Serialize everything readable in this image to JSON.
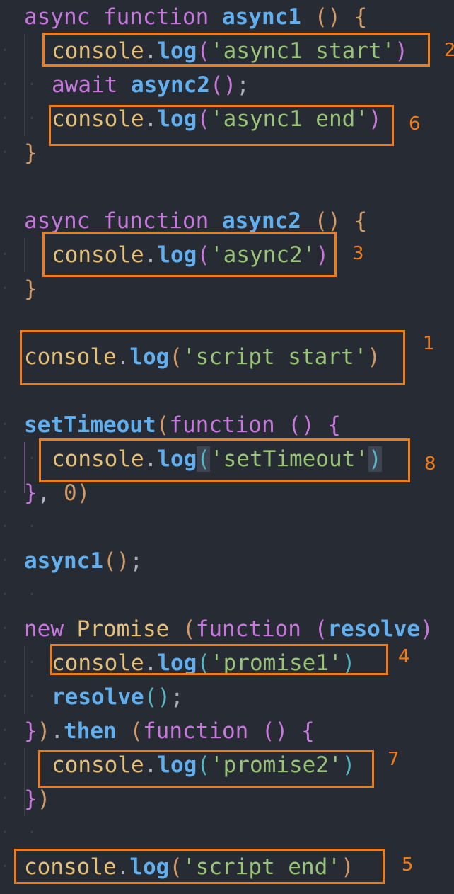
{
  "code": {
    "l1": {
      "kw": "async function ",
      "name": "async1",
      "rest_open": " () ",
      "brace": "{"
    },
    "l2": {
      "obj": "console",
      "dot": ".",
      "method": "log",
      "open": "(",
      "str": "'async1 start'",
      "close": ")"
    },
    "l3": {
      "kw": "await ",
      "call": "async2",
      "parens": "()",
      "semi": ";"
    },
    "l4": {
      "obj": "console",
      "dot": ".",
      "method": "log",
      "open": "(",
      "str": "'async1 end'",
      "close": ")"
    },
    "l5": {
      "brace": "}"
    },
    "l7": {
      "kw": "async function ",
      "name": "async2",
      "rest_open": " () ",
      "brace": "{"
    },
    "l8": {
      "obj": "console",
      "dot": ".",
      "method": "log",
      "open": "(",
      "str": "'async2'",
      "close": ")"
    },
    "l9": {
      "brace": "}"
    },
    "l11": {
      "obj": "console",
      "dot": ".",
      "method": "log",
      "open": "(",
      "str": "'script start'",
      "close": ")"
    },
    "l13": {
      "name": "setTimeout",
      "open": "(",
      "kw": "function",
      "parens": " () ",
      "brace": "{"
    },
    "l14": {
      "obj": "console",
      "dot": ".",
      "method": "log",
      "open": "(",
      "str": "'setTimeout'",
      "close": ")"
    },
    "l15": {
      "brace": "}",
      "comma": ", ",
      "num": "0",
      "close": ")"
    },
    "l17": {
      "call": "async1",
      "parens": "()",
      "semi": ";"
    },
    "l19": {
      "kw": "new ",
      "cls": "Promise",
      "sp": " ",
      "open": "(",
      "fnkw": "function",
      "sp2": " ",
      "p_open": "(",
      "param": "resolve",
      "p_close": ")"
    },
    "l20": {
      "obj": "console",
      "dot": ".",
      "method": "log",
      "open": "(",
      "str": "'promise1'",
      "close": ")"
    },
    "l21": {
      "call": "resolve",
      "parens": "()",
      "semi": ";"
    },
    "l22": {
      "brace": "}",
      "close": ")",
      "dot": ".",
      "method": "then",
      "sp": " ",
      "open": "(",
      "kw": "function",
      "parens": " () ",
      "brace2": "{"
    },
    "l23": {
      "obj": "console",
      "dot": ".",
      "method": "log",
      "open": "(",
      "str": "'promise2'",
      "close": ")"
    },
    "l24": {
      "brace": "}",
      "close": ")"
    },
    "l26": {
      "obj": "console",
      "dot": ".",
      "method": "log",
      "open": "(",
      "str": "'script end'",
      "close": ")"
    }
  },
  "annotations": {
    "async1_start": "2",
    "async1_end": "6",
    "async2": "3",
    "script_start": "1",
    "settimeout": "8",
    "promise1": "4",
    "promise2": "7",
    "script_end": "5"
  },
  "colors": {
    "background": "#272b33",
    "highlight_box": "#f27b13",
    "keyword": "#c678dd",
    "function": "#61afef",
    "object": "#e5c07b",
    "string": "#98c379"
  }
}
